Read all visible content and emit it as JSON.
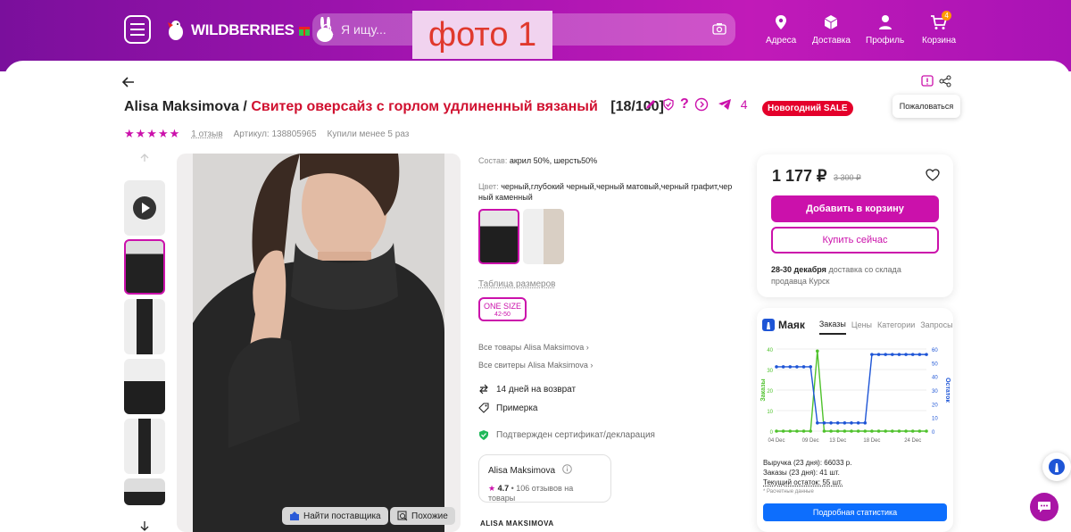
{
  "header": {
    "logo_text": "WILDBERRIES",
    "search_placeholder": "Я ищу...",
    "overlay_label": "фото 1",
    "nav": [
      {
        "label": "Адреса",
        "icon": "location-icon"
      },
      {
        "label": "Доставка",
        "icon": "box-icon"
      },
      {
        "label": "Профиль",
        "icon": "user-icon"
      },
      {
        "label": "Корзина",
        "icon": "cart-icon",
        "badge": "4"
      }
    ]
  },
  "product": {
    "brand": "Alisa Maksimova",
    "separator": "/",
    "name": "Свитер оверсайз с горлом удлиненный вязаный",
    "article_tag": "[18/100]",
    "telegram_count": "4",
    "sale_badge": "Новогодний SALE",
    "stars": "★★★★★",
    "reviews": "1 отзыв",
    "article": "Артикул: 138805965",
    "bought": "Купили менее 5 раз",
    "composition_label": "Состав:",
    "composition": "акрил 50%, шерсть50%",
    "color_label": "Цвет:",
    "color_line1": "черный,глубокий черный,черный матовый,черный графит,чер",
    "color_line2": "ный каменный",
    "size_table": "Таблица размеров",
    "size_name": "ONE SIZE",
    "size_range": "42-50",
    "all_goods": "Все товары Alisa Maksimova",
    "all_sweaters": "Все свитеры Alisa Maksimova",
    "return_days": "14 дней на возврат",
    "fitting": "Примерка",
    "certificate": "Подтвержден сертификат/декларация",
    "seller_name": "Alisa Maksimova",
    "seller_rating": "4.7",
    "seller_reviews": "106 отзывов на товары",
    "brand_logo": "ALISA MAKSIMOVA",
    "find_supplier": "Найти поставщика",
    "similar": "Похожие"
  },
  "buy": {
    "price": "1 177 ₽",
    "old_price": "3 300 ₽",
    "add_to_cart": "Добавить в корзину",
    "buy_now": "Купить сейчас",
    "delivery_date": "28-30 декабря",
    "delivery_text1": "доставка со склада",
    "delivery_text2": "продавца Курск"
  },
  "tooltip": "Пожаловаться",
  "mayak": {
    "brand": "Маяк",
    "tabs": [
      "Заказы",
      "Цены",
      "Категории",
      "Запросы"
    ],
    "active_tab": "Заказы",
    "revenue": "Выручка (23 дня): 66033 р.",
    "orders": "Заказы (23 дня): 41 шт.",
    "stock": "Текущий остаток: 55 шт.",
    "note": "* Расчетные данные",
    "details_button": "Подробная статистика"
  },
  "chart_data": {
    "type": "line",
    "x": [
      "04 Dec",
      "05 Dec",
      "06 Dec",
      "07 Dec",
      "08 Dec",
      "09 Dec",
      "10 Dec",
      "11 Dec",
      "12 Dec",
      "13 Dec",
      "14 Dec",
      "15 Dec",
      "16 Dec",
      "17 Dec",
      "18 Dec",
      "19 Dec",
      "20 Dec",
      "21 Dec",
      "22 Dec",
      "23 Dec",
      "24 Dec",
      "25 Dec",
      "26 Dec"
    ],
    "xticks": [
      "04 Dec",
      "09 Dec",
      "13 Dec",
      "18 Dec",
      "24 Dec"
    ],
    "ylabel_left": "Заказы",
    "ylabel_right": "Остаток",
    "ylim_left": [
      0,
      40
    ],
    "ylim_right": [
      0,
      60
    ],
    "yticks_left": [
      0,
      10,
      20,
      30,
      40
    ],
    "yticks_right": [
      0,
      10,
      20,
      30,
      40,
      50,
      60
    ],
    "series": [
      {
        "axis": "left",
        "color": "#4fc22c",
        "values": [
          0,
          0,
          0,
          0,
          0,
          0,
          39,
          0,
          0,
          0,
          0,
          0,
          0,
          0,
          0,
          0,
          0,
          0,
          0,
          0,
          0,
          0,
          0
        ]
      },
      {
        "axis": "right",
        "color": "#1e55d6",
        "values": [
          47,
          47,
          47,
          47,
          47,
          47,
          6,
          6,
          6,
          6,
          6,
          6,
          6,
          6,
          56,
          56,
          56,
          56,
          56,
          56,
          56,
          56,
          56
        ]
      }
    ]
  }
}
